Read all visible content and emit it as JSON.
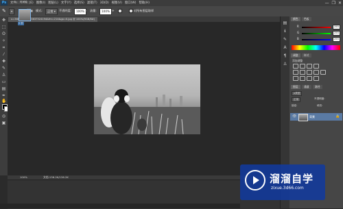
{
  "app": {
    "logo": "Ps"
  },
  "menu": {
    "items": [
      "文件(F)",
      "编辑(E)",
      "图像(I)",
      "图层(L)",
      "文字(Y)",
      "选择(S)",
      "滤镜(T)",
      "3D(D)",
      "视图(V)",
      "窗口(W)",
      "帮助(H)"
    ]
  },
  "window_controls": {
    "minimize": "—",
    "restore": "❐",
    "close": "✕"
  },
  "options_bar": {
    "mode_label": "模式:",
    "mode_value": "正常",
    "opacity_label": "不透明度:",
    "opacity_value": "100%",
    "flow_label": "流量:",
    "flow_value": "100%",
    "sample_label": "对所有图层取样"
  },
  "document": {
    "tab_title": "u=3665425414,3637524194&fm=214&gp=0.jpg @ 100%(RGB/8#)"
  },
  "status_bar": {
    "zoom": "100%",
    "doc_info": "文档:136.2K/136.2K"
  },
  "mini_bridge": {
    "tab_label": "时间轴",
    "thumb_label": "0 秒"
  },
  "panels": {
    "color_tab": "颜色",
    "swatches_tab": "色板",
    "sliders": [
      {
        "label": "R",
        "value": 255,
        "color": "#ff3b3b"
      },
      {
        "label": "G",
        "value": 255,
        "color": "#3bcc3b"
      },
      {
        "label": "B",
        "value": 255,
        "color": "#3b7bff"
      }
    ],
    "adjustments_tab": "调整",
    "styles_tab": "样式",
    "add_adjustment_label": "添加调整",
    "layers_tab": "图层",
    "channels_tab": "通道",
    "paths_tab": "路径",
    "kind_label": "ρ类型",
    "blend_mode": "正常",
    "opacity_label": "不透明度:",
    "lock_label": "锁定:",
    "fill_label": "填充:",
    "layer_name": "背景"
  },
  "watermark": {
    "title": "溜溜自学",
    "url": "zixue.3d66.com"
  },
  "colors": {
    "accent_blue": "#5a7aa3",
    "watermark_blue": "#103aa0"
  }
}
